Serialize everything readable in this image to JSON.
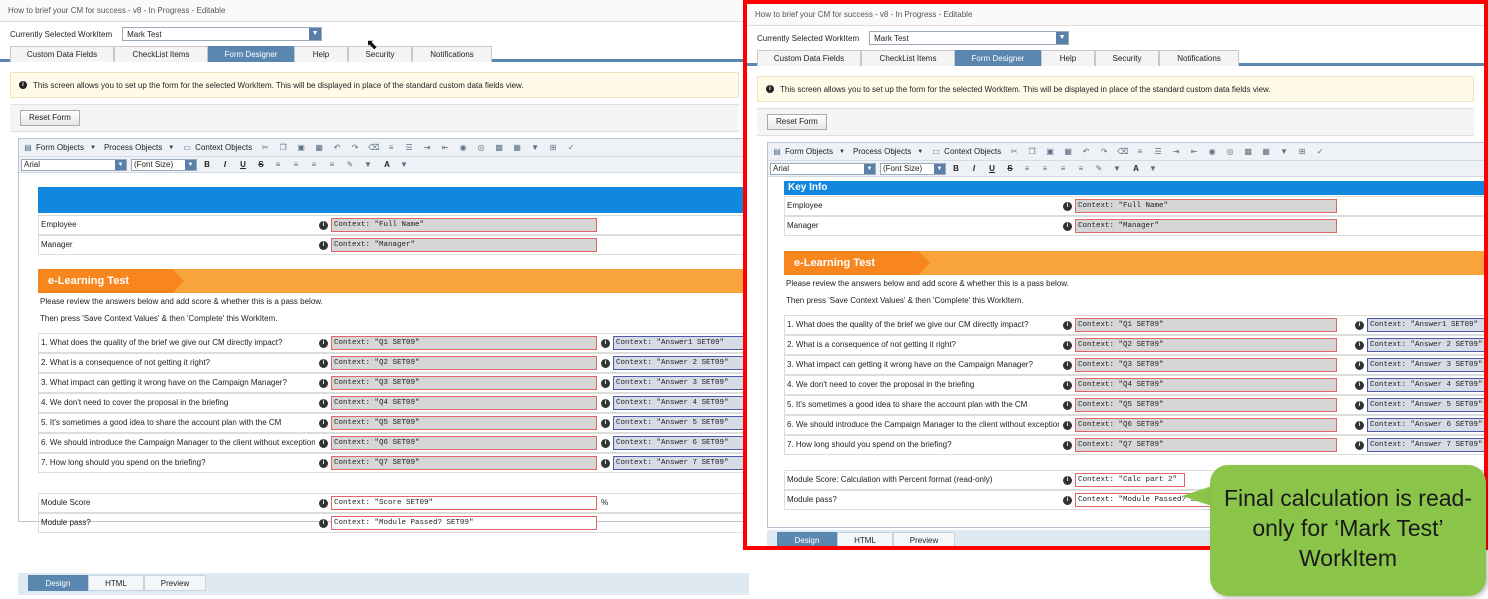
{
  "window_title": "How to brief your CM for success - v8 - In Progress - Editable",
  "workitem_label": "Currently Selected WorkItem",
  "workitem_value": "Mark Test",
  "tabs": [
    "Custom Data Fields",
    "CheckList Items",
    "Form Designer",
    "Help",
    "Security",
    "Notifications"
  ],
  "active_tab": "Form Designer",
  "info_text": "This screen allows you to set up the form for the selected WorkItem.  This will be displayed in place of the standard custom data fields view.",
  "reset_button": "Reset Form",
  "toolbar": {
    "form_objects": "Form Objects",
    "process_objects": "Process Objects",
    "context_objects": "Context Objects",
    "font_name": "Arial",
    "font_size": "(Font Size)",
    "bold": "B",
    "italic": "I",
    "underline": "U",
    "strike": "S",
    "font_color": "A"
  },
  "form": {
    "key_info_title": "Key Info",
    "employee_label": "Employee",
    "employee_ctx": "Context: \"Full Name\"",
    "manager_label": "Manager",
    "manager_ctx": "Context: \"Manager\"",
    "elearning_title": "e-Learning Test",
    "instruction1": "Please review the answers below and add score & whether this is a pass below.",
    "instruction2": "Then press 'Save Context Values' & then 'Complete' this WorkItem.",
    "questions": [
      {
        "label": "1. What does the quality of the brief we give our CM directly impact?",
        "q_ctx": "Context: \"Q1 SET09\"",
        "a_ctx": "Context: \"Answer1 SET09\""
      },
      {
        "label": "2. What is a consequence of not getting it right?",
        "q_ctx": "Context: \"Q2 SET09\"",
        "a_ctx": "Context: \"Answer 2 SET09\""
      },
      {
        "label": "3. What impact can getting it wrong have on the Campaign Manager?",
        "q_ctx": "Context: \"Q3 SET09\"",
        "a_ctx": "Context: \"Answer 3 SET09\""
      },
      {
        "label": "4. We don't need to cover the proposal in the briefing",
        "q_ctx": "Context: \"Q4 SET09\"",
        "a_ctx": "Context: \"Answer 4 SET09\""
      },
      {
        "label": "5. It's sometimes a good idea to share the account plan with the CM",
        "q_ctx": "Context: \"Q5 SET09\"",
        "a_ctx": "Context: \"Answer 5 SET09\""
      },
      {
        "label": "6. We should introduce the Campaign Manager to the client without exception",
        "q_ctx": "Context: \"Q6 SET09\"",
        "a_ctx": "Context: \"Answer 6 SET09\""
      },
      {
        "label": "7. How long should you spend on the briefing?",
        "q_ctx": "Context: \"Q7 SET09\"",
        "a_ctx": "Context: \"Answer 7 SET09\""
      }
    ],
    "left_score_label": "Module Score",
    "left_score_ctx": "Context: \"Score SET09\"",
    "percent": "%",
    "right_score_label": "Module Score: Calculation with Percent format (read-only)",
    "right_score_ctx": "Context: \"Calc part 2\"",
    "pass_label": "Module pass?",
    "pass_ctx": "Context: \"Module Passed? SET09\"",
    "pass_ctx_right": "Context: \"Module Passed? SET0"
  },
  "bottom_tabs": [
    "Design",
    "HTML",
    "Preview"
  ],
  "callout": "Final calculation is read-only for ‘Mark Test’ WorkItem",
  "colors": {
    "tab_active": "#5a87b0",
    "header_blue": "#1188dd",
    "header_orange": "#f8a33c",
    "chevron_orange": "#f7861f",
    "highlight_red": "#ff0000",
    "callout_green": "#8ac54a"
  }
}
